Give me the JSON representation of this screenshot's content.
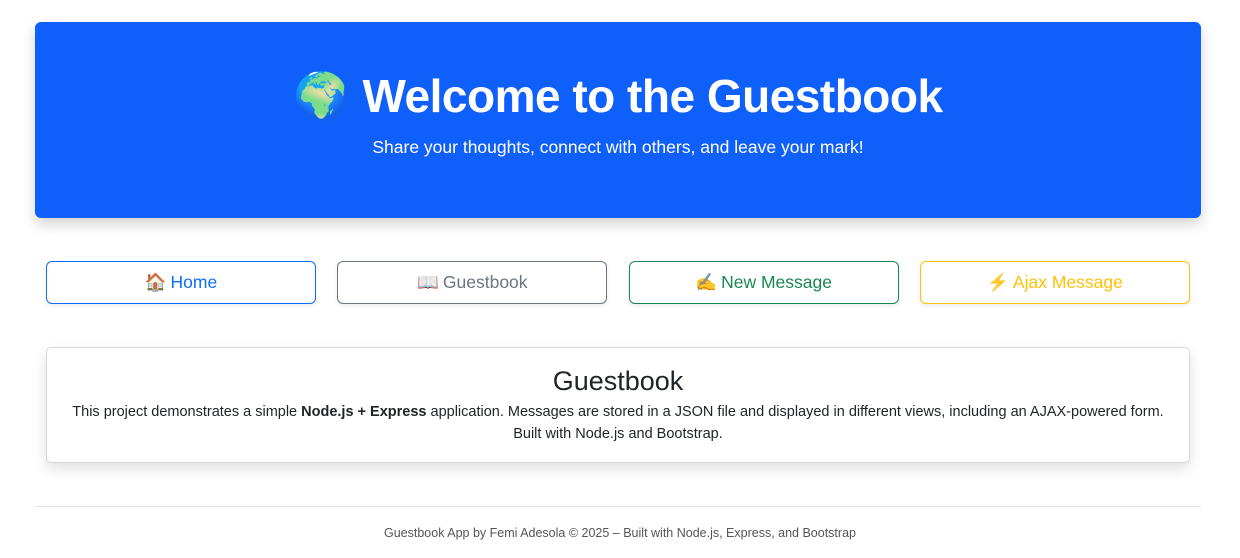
{
  "hero": {
    "icon": "🌍",
    "title": "Welcome to the Guestbook",
    "subtitle": "Share your thoughts, connect with others, and leave your mark!"
  },
  "nav": [
    {
      "icon": "🏠",
      "label": "Home",
      "color": "#0d6efd"
    },
    {
      "icon": "📖",
      "label": "Guestbook",
      "color": "#6c757d"
    },
    {
      "icon": "✍️",
      "label": "New Message",
      "color": "#198754"
    },
    {
      "icon": "⚡",
      "label": "Ajax Message",
      "color": "#ffc107"
    }
  ],
  "card": {
    "title": "Guestbook",
    "text_before": "This project demonstrates a simple ",
    "text_bold": "Node.js + Express",
    "text_after": " application. Messages are stored in a JSON file and displayed in different views, including an AJAX-powered form. Built with Node.js and Bootstrap."
  },
  "footer": {
    "text": "Guestbook App by Femi Adesola © 2025 – Built with Node.js, Express, and Bootstrap"
  },
  "colors": {
    "brand": "#0f5ffb"
  }
}
